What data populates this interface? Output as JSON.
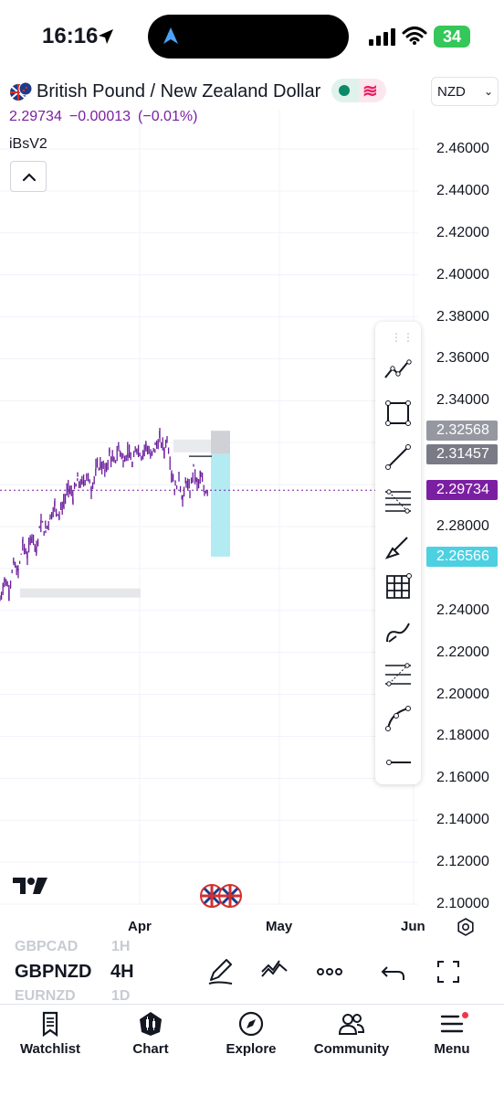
{
  "status_bar": {
    "time": "16:16",
    "battery": "34"
  },
  "header": {
    "symbol_title": "British Pound / New Zealand Dollar",
    "currency": "NZD",
    "last_price": "2.29734",
    "change": "−0.00013",
    "change_pct": "(−0.01%)",
    "indicator": "iBsV2"
  },
  "chart_data": {
    "type": "candlestick",
    "symbol": "GBPNZD",
    "interval": "4H",
    "y_ticks": [
      "2.46000",
      "2.44000",
      "2.42000",
      "2.40000",
      "2.38000",
      "2.36000",
      "2.34000",
      "2.28000",
      "2.24000",
      "2.22000",
      "2.20000",
      "2.18000",
      "2.16000",
      "2.14000",
      "2.12000",
      "2.10000"
    ],
    "ylim": [
      2.1,
      2.47
    ],
    "x_ticks": [
      "Apr",
      "May",
      "Jun"
    ],
    "price_badges": [
      {
        "label": "2.32568",
        "value": 2.32568,
        "color": "#9598a1"
      },
      {
        "label": "2.31457",
        "value": 2.31457,
        "color": "#787b86"
      },
      {
        "label": "2.29734",
        "value": 2.29734,
        "color": "#7b1fa2"
      },
      {
        "label": "2.26566",
        "value": 2.26566,
        "color": "#4dd0e1"
      }
    ],
    "price_path": [
      [
        0,
        2.245
      ],
      [
        5,
        2.255
      ],
      [
        10,
        2.25
      ],
      [
        15,
        2.262
      ],
      [
        20,
        2.258
      ],
      [
        25,
        2.272
      ],
      [
        30,
        2.266
      ],
      [
        35,
        2.276
      ],
      [
        40,
        2.27
      ],
      [
        45,
        2.282
      ],
      [
        50,
        2.278
      ],
      [
        55,
        2.285
      ],
      [
        60,
        2.29
      ],
      [
        65,
        2.286
      ],
      [
        70,
        2.292
      ],
      [
        75,
        2.298
      ],
      [
        80,
        2.294
      ],
      [
        85,
        2.302
      ],
      [
        90,
        2.3
      ],
      [
        95,
        2.305
      ],
      [
        100,
        2.298
      ],
      [
        105,
        2.307
      ],
      [
        110,
        2.31
      ],
      [
        115,
        2.306
      ],
      [
        120,
        2.315
      ],
      [
        125,
        2.31
      ],
      [
        130,
        2.318
      ],
      [
        135,
        2.312
      ],
      [
        140,
        2.316
      ],
      [
        145,
        2.309
      ],
      [
        150,
        2.318
      ],
      [
        155,
        2.314
      ],
      [
        160,
        2.319
      ],
      [
        165,
        2.313
      ],
      [
        170,
        2.318
      ],
      [
        175,
        2.322
      ],
      [
        180,
        2.316
      ],
      [
        183,
        2.323
      ],
      [
        188,
        2.305
      ],
      [
        192,
        2.298
      ],
      [
        196,
        2.305
      ],
      [
        200,
        2.292
      ],
      [
        204,
        2.302
      ],
      [
        208,
        2.296
      ],
      [
        212,
        2.308
      ],
      [
        216,
        2.3
      ],
      [
        220,
        2.303
      ],
      [
        224,
        2.297
      ],
      [
        228,
        2.298
      ]
    ]
  },
  "symbol_switcher": {
    "prev_symbol": "GBPCAD",
    "current_symbol": "GBPNZD",
    "next_symbol": "EURNZD",
    "prev_interval": "1H",
    "current_interval": "4H",
    "next_interval": "1D"
  },
  "tabs": [
    {
      "label": "Watchlist",
      "icon": "bookmark-icon"
    },
    {
      "label": "Chart",
      "icon": "candles-icon"
    },
    {
      "label": "Explore",
      "icon": "compass-icon"
    },
    {
      "label": "Community",
      "icon": "people-icon"
    },
    {
      "label": "Menu",
      "icon": "menu-icon"
    }
  ],
  "colors": {
    "accent": "#7b1fa2",
    "candle": "#6a1b9a",
    "zone": "#b2ebf2",
    "bg": "#ffffff"
  }
}
